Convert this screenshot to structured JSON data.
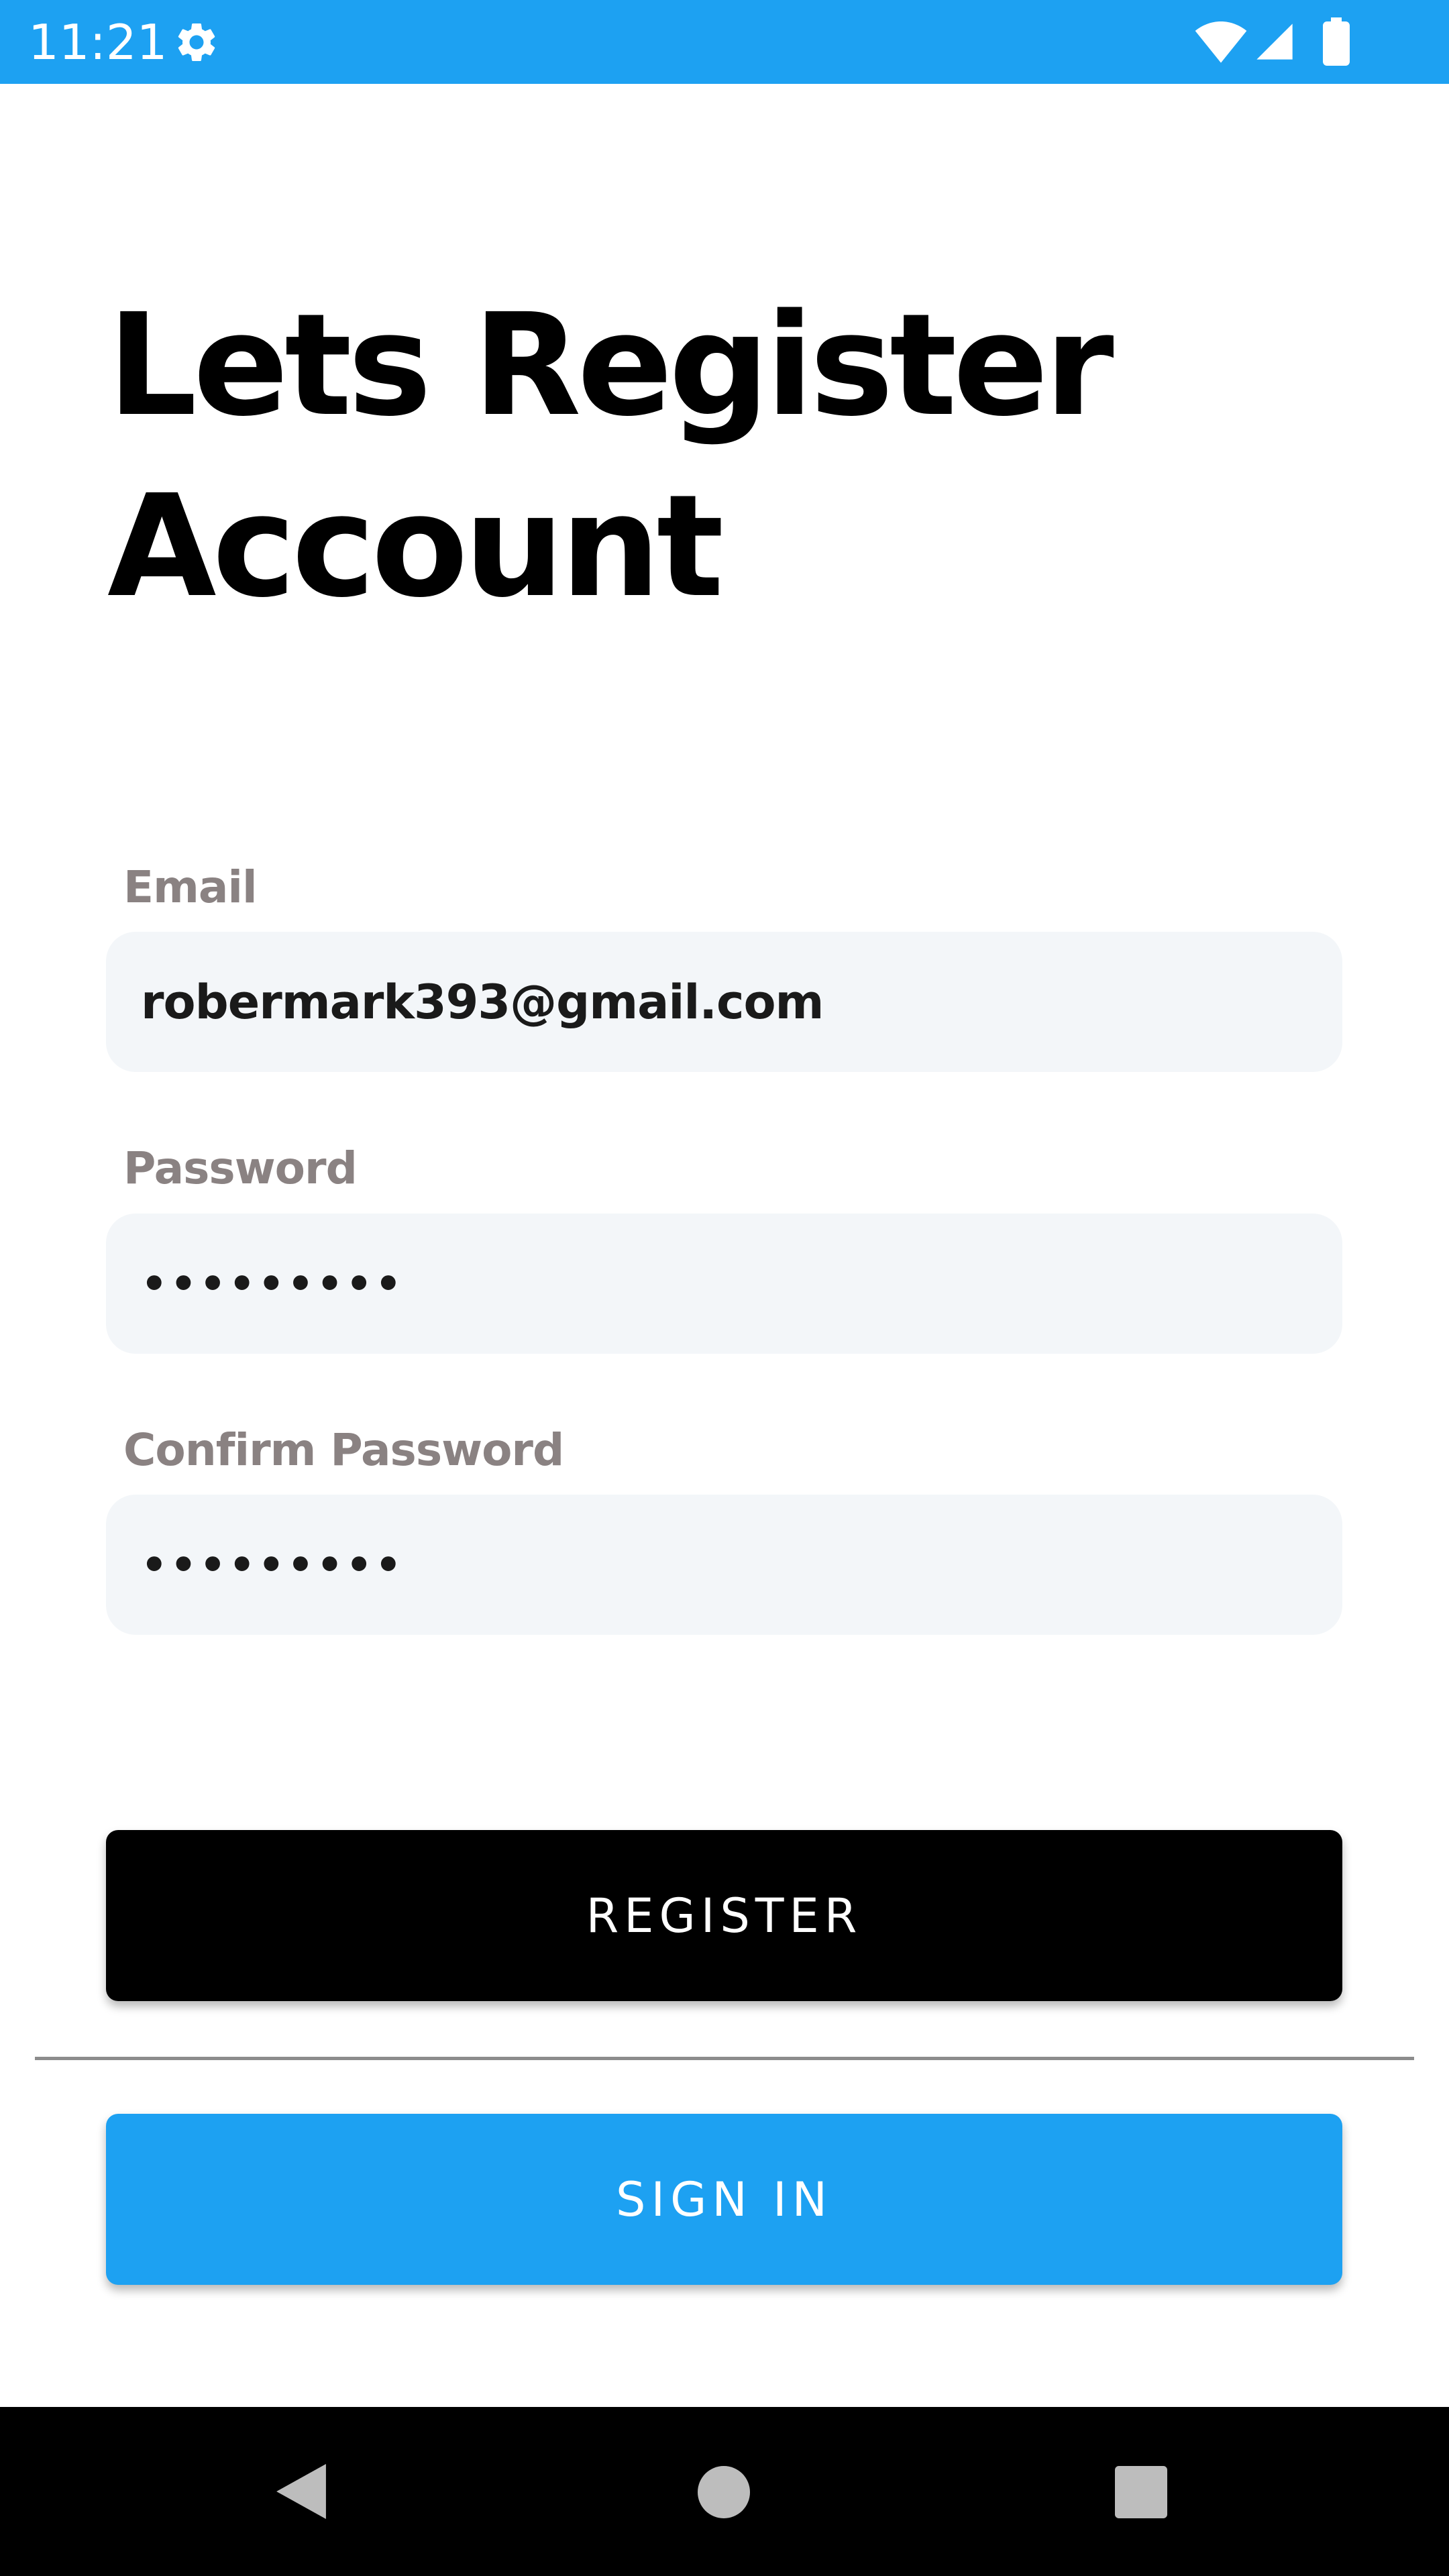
{
  "status_bar": {
    "time": "11:21",
    "icons": [
      "gear-icon",
      "wifi-icon",
      "signal-icon",
      "battery-icon"
    ],
    "background_color": "#1da1f2"
  },
  "title": {
    "line1": "Lets Register",
    "line2": "Account"
  },
  "form": {
    "email": {
      "label": "Email",
      "value": "robermark393@gmail.com"
    },
    "password": {
      "label": "Password",
      "value": "•••••••••"
    },
    "confirm_password": {
      "label": "Confirm Password",
      "value": "•••••••••"
    }
  },
  "buttons": {
    "register_label": "REGISTER",
    "register_color": "#000000",
    "signin_label": "SIGN IN",
    "signin_color": "#1da1f2"
  },
  "nav_bar": {
    "icons": [
      "back-icon",
      "home-icon",
      "recents-icon"
    ]
  }
}
